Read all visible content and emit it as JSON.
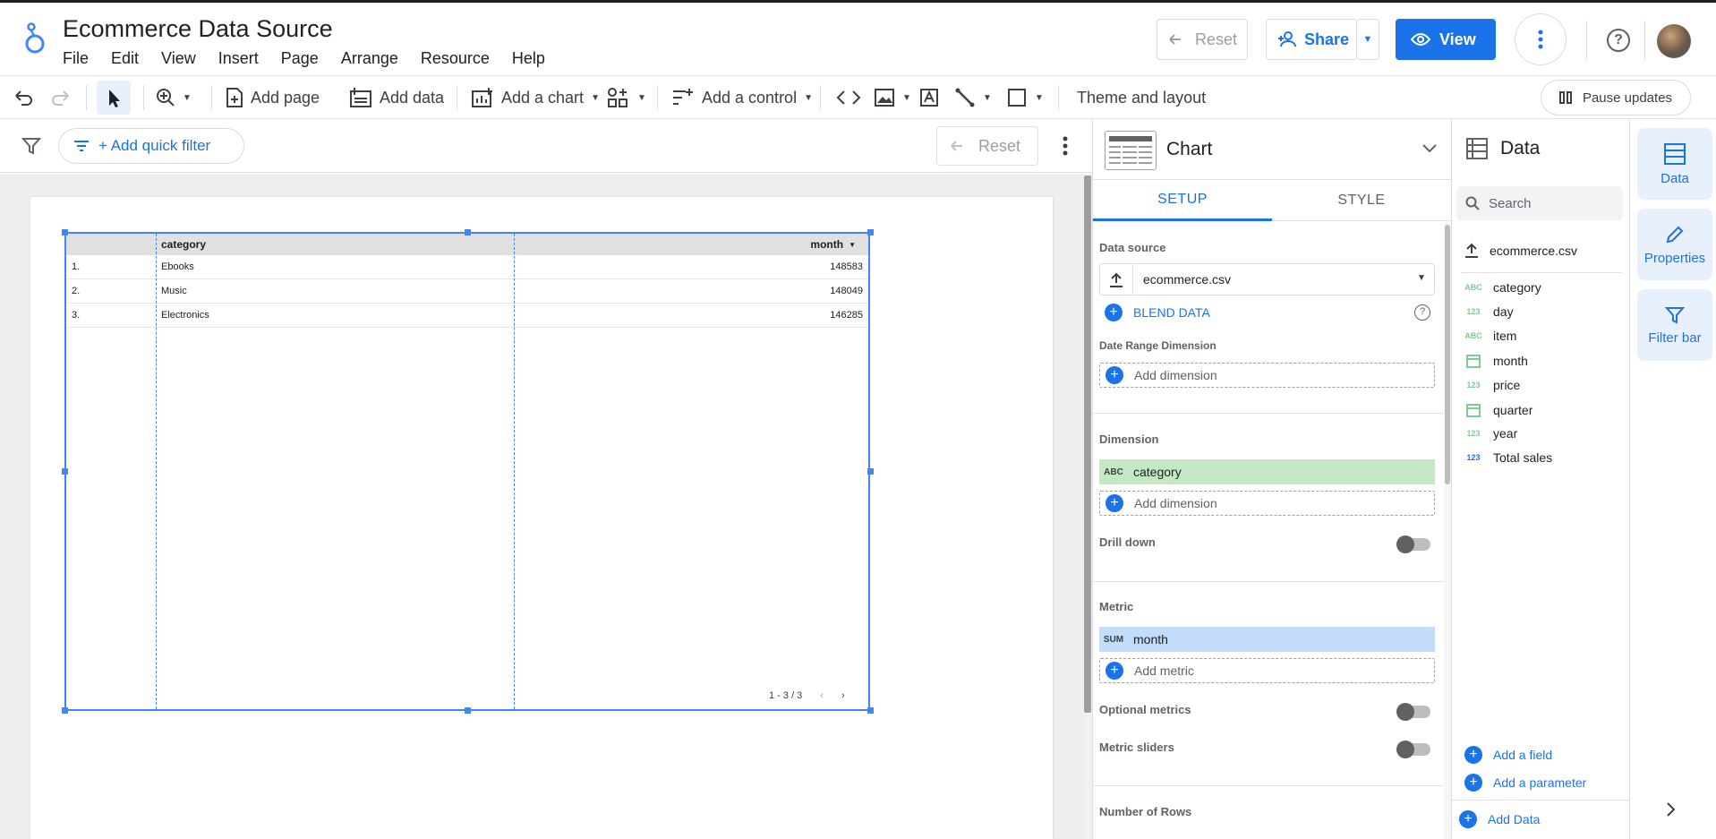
{
  "app": {
    "title": "Ecommerce Data Source",
    "menu": [
      "File",
      "Edit",
      "View",
      "Insert",
      "Page",
      "Arrange",
      "Resource",
      "Help"
    ]
  },
  "header": {
    "reset_label": "Reset",
    "share_label": "Share",
    "view_label": "View"
  },
  "toolbar": {
    "add_page": "Add page",
    "add_data": "Add data",
    "add_chart": "Add a chart",
    "add_control": "Add a control",
    "theme_layout": "Theme and layout",
    "pause_updates": "Pause updates"
  },
  "filterbar": {
    "quick_filter": "+ Add quick filter",
    "reset_label": "Reset"
  },
  "table": {
    "headers": [
      "category",
      "month"
    ],
    "rows": [
      {
        "index": "1.",
        "category": "Ebooks",
        "month": "148583"
      },
      {
        "index": "2.",
        "category": "Music",
        "month": "148049"
      },
      {
        "index": "3.",
        "category": "Electronics",
        "month": "146285"
      }
    ],
    "pager": "1 - 3 / 3"
  },
  "chart_panel": {
    "title": "Chart",
    "tabs": [
      "SETUP",
      "STYLE"
    ],
    "data_source_label": "Data source",
    "data_source_value": "ecommerce.csv",
    "blend_data": "BLEND DATA",
    "date_range_label": "Date Range Dimension",
    "add_dimension": "Add dimension",
    "dimension_label": "Dimension",
    "dimension_tag": "ABC",
    "dimension_value": "category",
    "drill_down": "Drill down",
    "metric_label": "Metric",
    "metric_tag": "SUM",
    "metric_value": "month",
    "add_metric": "Add metric",
    "optional_metrics": "Optional metrics",
    "metric_sliders": "Metric sliders",
    "number_of_rows": "Number of Rows"
  },
  "data_panel": {
    "title": "Data",
    "search_placeholder": "Search",
    "source": "ecommerce.csv",
    "fields": [
      {
        "type": "ABC",
        "name": "category"
      },
      {
        "type": "123",
        "name": "day"
      },
      {
        "type": "ABC",
        "name": "item"
      },
      {
        "type": "date",
        "name": "month"
      },
      {
        "type": "123",
        "name": "price"
      },
      {
        "type": "date",
        "name": "quarter"
      },
      {
        "type": "123",
        "name": "year"
      },
      {
        "type": "123",
        "name": "Total sales"
      }
    ],
    "add_field": "Add a field",
    "add_parameter": "Add a parameter",
    "add_data": "Add Data"
  },
  "rail": {
    "data": "Data",
    "properties": "Properties",
    "filter_bar": "Filter bar"
  },
  "colors": {
    "accent": "#1a73e8",
    "dimension": "#c6e7c3",
    "metric": "#c2dcf9"
  }
}
